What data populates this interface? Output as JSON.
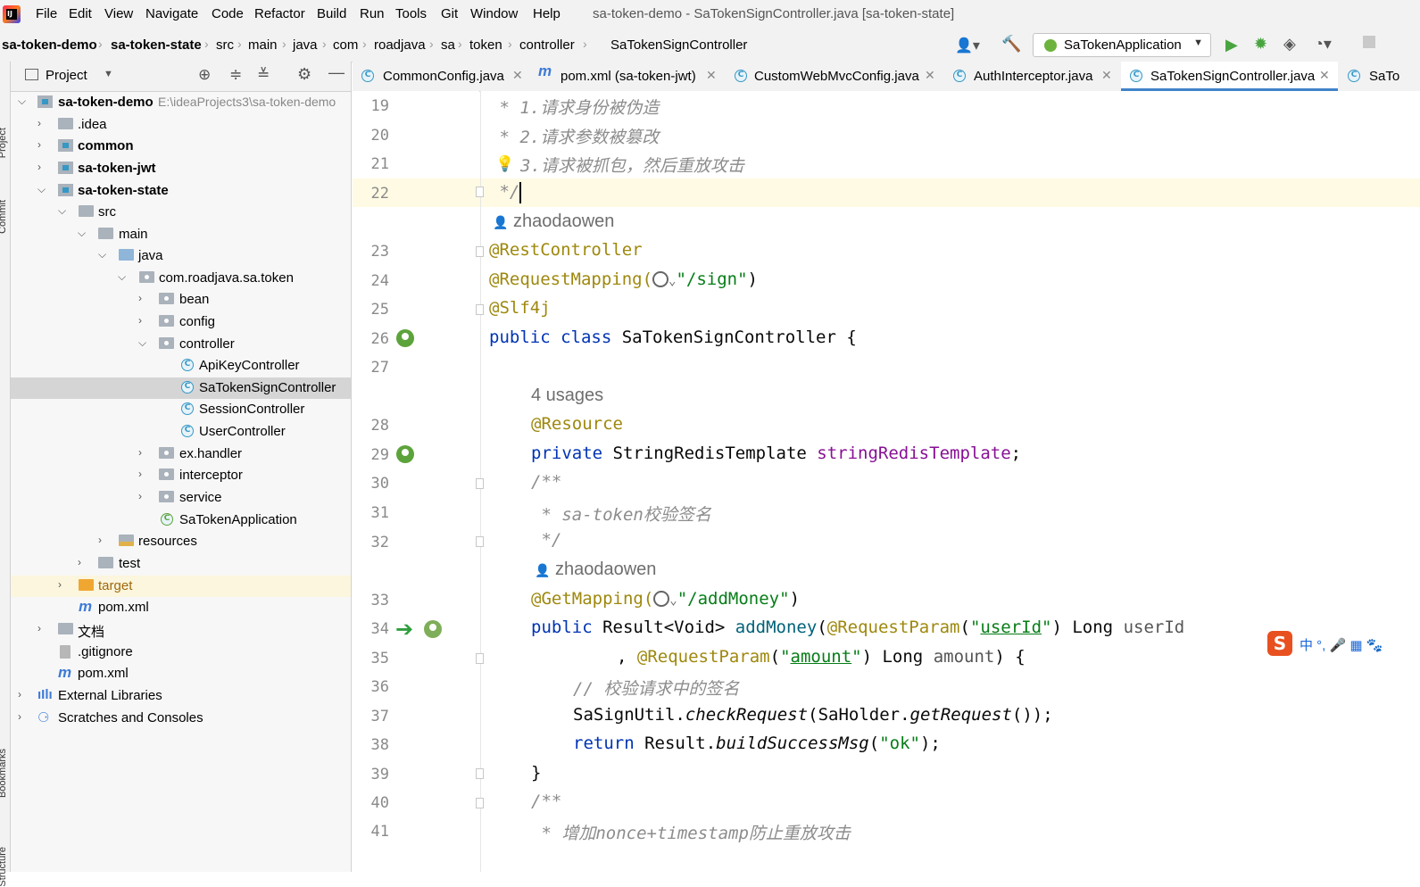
{
  "menubar": {
    "items": [
      "File",
      "Edit",
      "View",
      "Navigate",
      "Code",
      "Refactor",
      "Build",
      "Run",
      "Tools",
      "Git",
      "Window",
      "Help"
    ],
    "window_title": "sa-token-demo - SaTokenSignController.java [sa-token-state]"
  },
  "breadcrumb": {
    "items": [
      "sa-token-demo",
      "sa-token-state",
      "src",
      "main",
      "java",
      "com",
      "roadjava",
      "sa",
      "token",
      "controller",
      "SaTokenSignController"
    ]
  },
  "run_config": {
    "label": "SaTokenApplication"
  },
  "left_strip": {
    "project_label": "Project",
    "commit_label": "Commit",
    "bookmarks_label": "Bookmarks",
    "structure_label": "Structure"
  },
  "project_panel": {
    "title": "Project",
    "tree": [
      {
        "label": "sa-token-demo",
        "hint": "E:\\ideaProjects3\\sa-token-demo"
      },
      {
        "label": ".idea"
      },
      {
        "label": "common"
      },
      {
        "label": "sa-token-jwt"
      },
      {
        "label": "sa-token-state"
      },
      {
        "label": "src"
      },
      {
        "label": "main"
      },
      {
        "label": "java"
      },
      {
        "label": "com.roadjava.sa.token"
      },
      {
        "label": "bean"
      },
      {
        "label": "config"
      },
      {
        "label": "controller"
      },
      {
        "label": "ApiKeyController"
      },
      {
        "label": "SaTokenSignController"
      },
      {
        "label": "SessionController"
      },
      {
        "label": "UserController"
      },
      {
        "label": "ex.handler"
      },
      {
        "label": "interceptor"
      },
      {
        "label": "service"
      },
      {
        "label": "SaTokenApplication"
      },
      {
        "label": "resources"
      },
      {
        "label": "test"
      },
      {
        "label": "target"
      },
      {
        "label": "pom.xml"
      },
      {
        "label": "文档"
      },
      {
        "label": ".gitignore"
      },
      {
        "label": "pom.xml"
      },
      {
        "label": "External Libraries"
      },
      {
        "label": "Scratches and Consoles"
      }
    ]
  },
  "editor_tabs": [
    {
      "label": "CommonConfig.java"
    },
    {
      "label": "pom.xml (sa-token-jwt)"
    },
    {
      "label": "CustomWebMvcConfig.java"
    },
    {
      "label": "AuthInterceptor.java"
    },
    {
      "label": "SaTokenSignController.java"
    },
    {
      "label": "SaTo"
    }
  ],
  "editor": {
    "line_numbers": [
      "19",
      "20",
      "21",
      "22",
      "23",
      "24",
      "25",
      "26",
      "27",
      "28",
      "29",
      "30",
      "31",
      "32",
      "33",
      "34",
      "35",
      "36",
      "37",
      "38",
      "39",
      "40",
      "41"
    ],
    "author_hint": "zhaodaowen",
    "usages_hint": "4 usages",
    "lines": {
      "l19": " * 1.请求身份被伪造",
      "l20": " * 2.请求参数被篡改",
      "l21": "3.请求被抓包，然后重放攻击",
      "l22": " */",
      "l23": "@RestController",
      "l24_ann": "@RequestMapping(",
      "l24_str": "\"/sign\"",
      "l24_end": ")",
      "l25": "@Slf4j",
      "l26_kw": "public class ",
      "l26_rest": "SaTokenSignController {",
      "l28": "@Resource",
      "l29_kw": "private ",
      "l29_type": "StringRedisTemplate ",
      "l29_field": "stringRedisTemplate",
      "l29_end": ";",
      "l30": "/**",
      "l31": " * sa-token校验签名",
      "l32": " */",
      "l33_ann": "@GetMapping(",
      "l33_str": "\"/addMoney\"",
      "l33_end": ")",
      "l34_kw": "public ",
      "l34_type": "Result<Void> ",
      "l34_meth": "addMoney",
      "l34_p1": "(",
      "l34_ann": "@RequestParam",
      "l34_p2": "(",
      "l34_q1": "\"",
      "l34_str": "userId",
      "l34_q2": "\"",
      "l34_p3": ") Long ",
      "l34_param": "userId",
      "l35_pre": ", ",
      "l35_ann": "@RequestParam",
      "l35_p1": "(",
      "l35_q1": "\"",
      "l35_str": "amount",
      "l35_q2": "\"",
      "l35_p2": ") Long ",
      "l35_param": "amount",
      "l35_end": ") {",
      "l36": "// 校验请求中的签名",
      "l37_a": "SaSignUtil.",
      "l37_b": "checkRequest",
      "l37_c": "(SaHolder.",
      "l37_d": "getRequest",
      "l37_e": "());",
      "l38_kw": "return ",
      "l38_a": "Result.",
      "l38_b": "buildSuccessMsg",
      "l38_c": "(",
      "l38_str": "\"ok\"",
      "l38_d": ");",
      "l39": "}",
      "l40": "/**",
      "l41": " * 增加nonce+timestamp防止重放攻击"
    }
  },
  "ime": {
    "chars": "中 °, 🎤 ▦ 🐾"
  },
  "colors": {
    "keyword": "#0033b3",
    "annotation": "#9e880d",
    "string": "#067d17",
    "comment": "#8c8c8c",
    "field": "#871094",
    "tab_active": "#4083c9"
  }
}
